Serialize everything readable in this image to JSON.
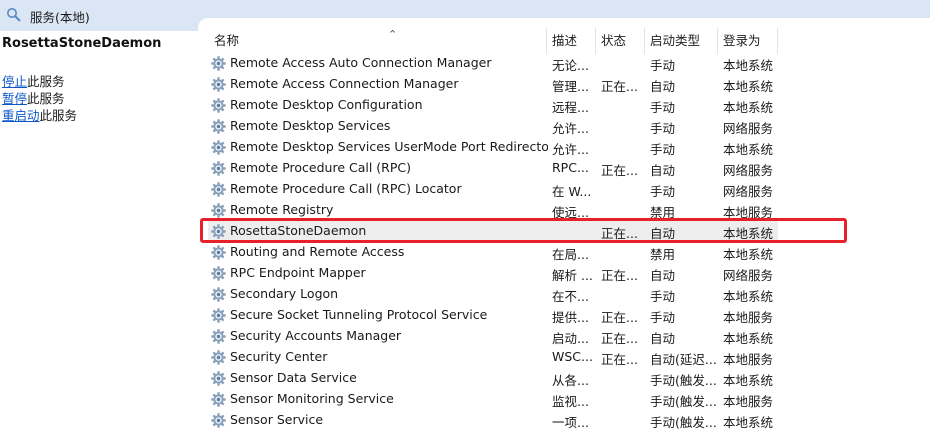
{
  "window": {
    "title": "服务(本地)"
  },
  "left_pane": {
    "service_name": "RosettaStoneDaemon",
    "actions": [
      {
        "link": "停止",
        "rest": "此服务"
      },
      {
        "link": "暂停",
        "rest": "此服务"
      },
      {
        "link": "重启动",
        "rest": "此服务"
      }
    ]
  },
  "columns": {
    "name": "名称",
    "description": "描述",
    "status": "状态",
    "startup": "启动类型",
    "logon": "登录为"
  },
  "services": [
    {
      "name": "Remote Access Auto Connection Manager",
      "desc": "无论...",
      "status": "",
      "startup": "手动",
      "logon": "本地系统"
    },
    {
      "name": "Remote Access Connection Manager",
      "desc": "管理...",
      "status": "正在...",
      "startup": "自动",
      "logon": "本地系统"
    },
    {
      "name": "Remote Desktop Configuration",
      "desc": "远程...",
      "status": "",
      "startup": "手动",
      "logon": "本地系统"
    },
    {
      "name": "Remote Desktop Services",
      "desc": "允许...",
      "status": "",
      "startup": "手动",
      "logon": "网络服务"
    },
    {
      "name": "Remote Desktop Services UserMode Port Redirector",
      "desc": "允许...",
      "status": "",
      "startup": "手动",
      "logon": "本地系统"
    },
    {
      "name": "Remote Procedure Call (RPC)",
      "desc": "RPC...",
      "status": "正在...",
      "startup": "自动",
      "logon": "网络服务"
    },
    {
      "name": "Remote Procedure Call (RPC) Locator",
      "desc": "在 W...",
      "status": "",
      "startup": "手动",
      "logon": "网络服务"
    },
    {
      "name": "Remote Registry",
      "desc": "使远...",
      "status": "",
      "startup": "禁用",
      "logon": "本地服务"
    },
    {
      "name": "RosettaStoneDaemon",
      "desc": "",
      "status": "正在...",
      "startup": "自动",
      "logon": "本地系统"
    },
    {
      "name": "Routing and Remote Access",
      "desc": "在局...",
      "status": "",
      "startup": "禁用",
      "logon": "本地系统"
    },
    {
      "name": "RPC Endpoint Mapper",
      "desc": "解析 ...",
      "status": "正在...",
      "startup": "自动",
      "logon": "网络服务"
    },
    {
      "name": "Secondary Logon",
      "desc": "在不...",
      "status": "",
      "startup": "手动",
      "logon": "本地系统"
    },
    {
      "name": "Secure Socket Tunneling Protocol Service",
      "desc": "提供...",
      "status": "正在...",
      "startup": "手动",
      "logon": "本地服务"
    },
    {
      "name": "Security Accounts Manager",
      "desc": "启动...",
      "status": "正在...",
      "startup": "自动",
      "logon": "本地系统"
    },
    {
      "name": "Security Center",
      "desc": "WSC...",
      "status": "正在...",
      "startup": "自动(延迟...",
      "logon": "本地服务"
    },
    {
      "name": "Sensor Data Service",
      "desc": "从各...",
      "status": "",
      "startup": "手动(触发...",
      "logon": "本地系统"
    },
    {
      "name": "Sensor Monitoring Service",
      "desc": "监视...",
      "status": "",
      "startup": "手动(触发...",
      "logon": "本地服务"
    },
    {
      "name": "Sensor Service",
      "desc": "一项...",
      "status": "",
      "startup": "手动(触发...",
      "logon": "本地系统"
    }
  ],
  "selected_service": "RosettaStoneDaemon",
  "colors": {
    "highlight": "#e8202a",
    "link": "#0b57c8",
    "topbar": "#dbe6f4",
    "selected_row": "#ededed"
  },
  "icons": {
    "window": "services-icon",
    "row": "gear-icon",
    "sort": "sort-ascending-icon"
  }
}
